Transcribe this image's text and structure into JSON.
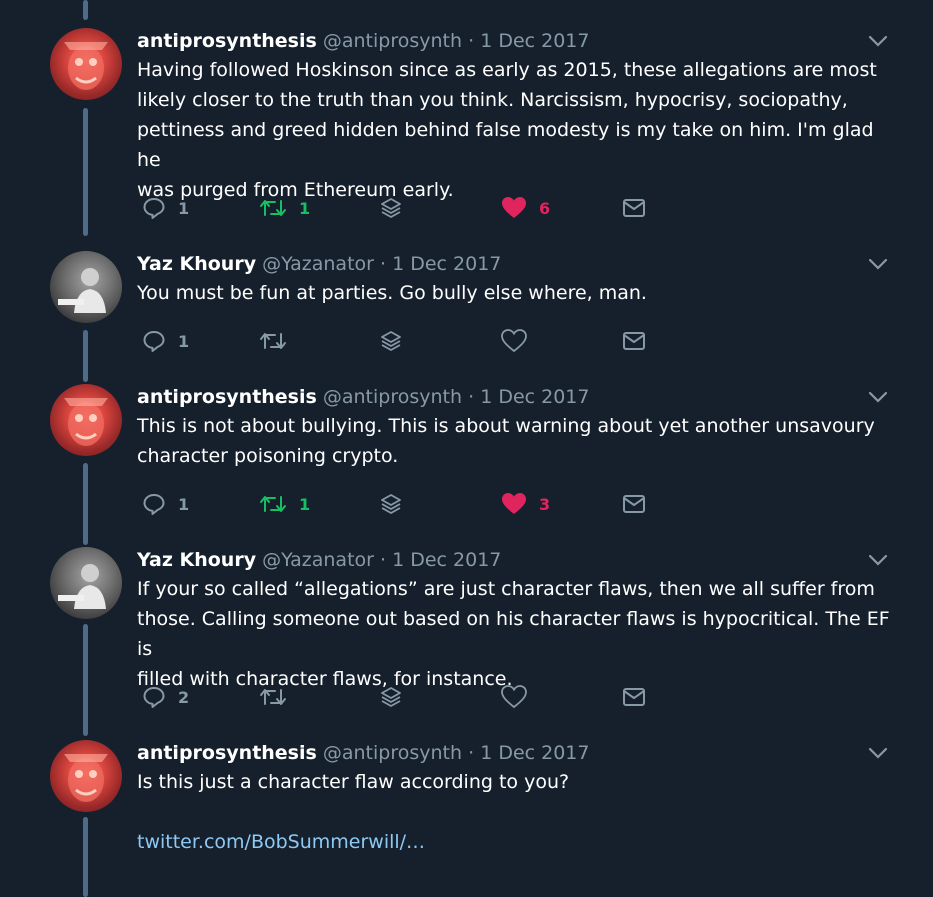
{
  "colors": {
    "background": "#16202c",
    "thread_line": "#4d6b8a",
    "secondary_text": "#8899a6",
    "retweet_active": "#17bf63",
    "like_active": "#e0245e",
    "link": "#8ec9f5"
  },
  "tweets": [
    {
      "name": "antiprosynthesis",
      "handle": "@antiprosynth",
      "separator": "·",
      "date": "1 Dec 2017",
      "text": "Having followed Hoskinson since as early as 2015, these allegations are most\nlikely closer to the truth than you think. Narcissism, hypocrisy, sociopathy,\npettiness and greed hidden behind false modesty is my take on him. I'm glad he\nwas purged from Ethereum early.",
      "replies": "1",
      "retweets": "1",
      "likes": "6",
      "retweeted": true,
      "liked": true
    },
    {
      "name": "Yaz Khoury",
      "handle": "@Yazanator",
      "separator": "·",
      "date": "1 Dec 2017",
      "text": "You must be fun at parties. Go bully else where, man.",
      "replies": "1",
      "retweets": "",
      "likes": "",
      "retweeted": false,
      "liked": false
    },
    {
      "name": "antiprosynthesis",
      "handle": "@antiprosynth",
      "separator": "·",
      "date": "1 Dec 2017",
      "text": "This is not about bullying. This is about warning about yet another unsavoury\ncharacter poisoning crypto.",
      "replies": "1",
      "retweets": "1",
      "likes": "3",
      "retweeted": true,
      "liked": true
    },
    {
      "name": "Yaz Khoury",
      "handle": "@Yazanator",
      "separator": "·",
      "date": "1 Dec 2017",
      "text": "If your so called “allegations” are just character flaws, then we all suffer from\nthose. Calling someone out based on his character flaws is hypocritical. The EF is\nfilled with character flaws, for instance.",
      "replies": "2",
      "retweets": "",
      "likes": "",
      "retweeted": false,
      "liked": false
    },
    {
      "name": "antiprosynthesis",
      "handle": "@antiprosynth",
      "separator": "·",
      "date": "1 Dec 2017",
      "text": "Is this just a character flaw according to you?",
      "link": "twitter.com/BobSummerwill/…"
    }
  ],
  "icons": {
    "reply": "reply-icon",
    "retweet": "retweet-icon",
    "share_stack": "stack-icon",
    "like": "heart-icon",
    "dm": "envelope-icon",
    "menu": "chevron-down-icon"
  }
}
